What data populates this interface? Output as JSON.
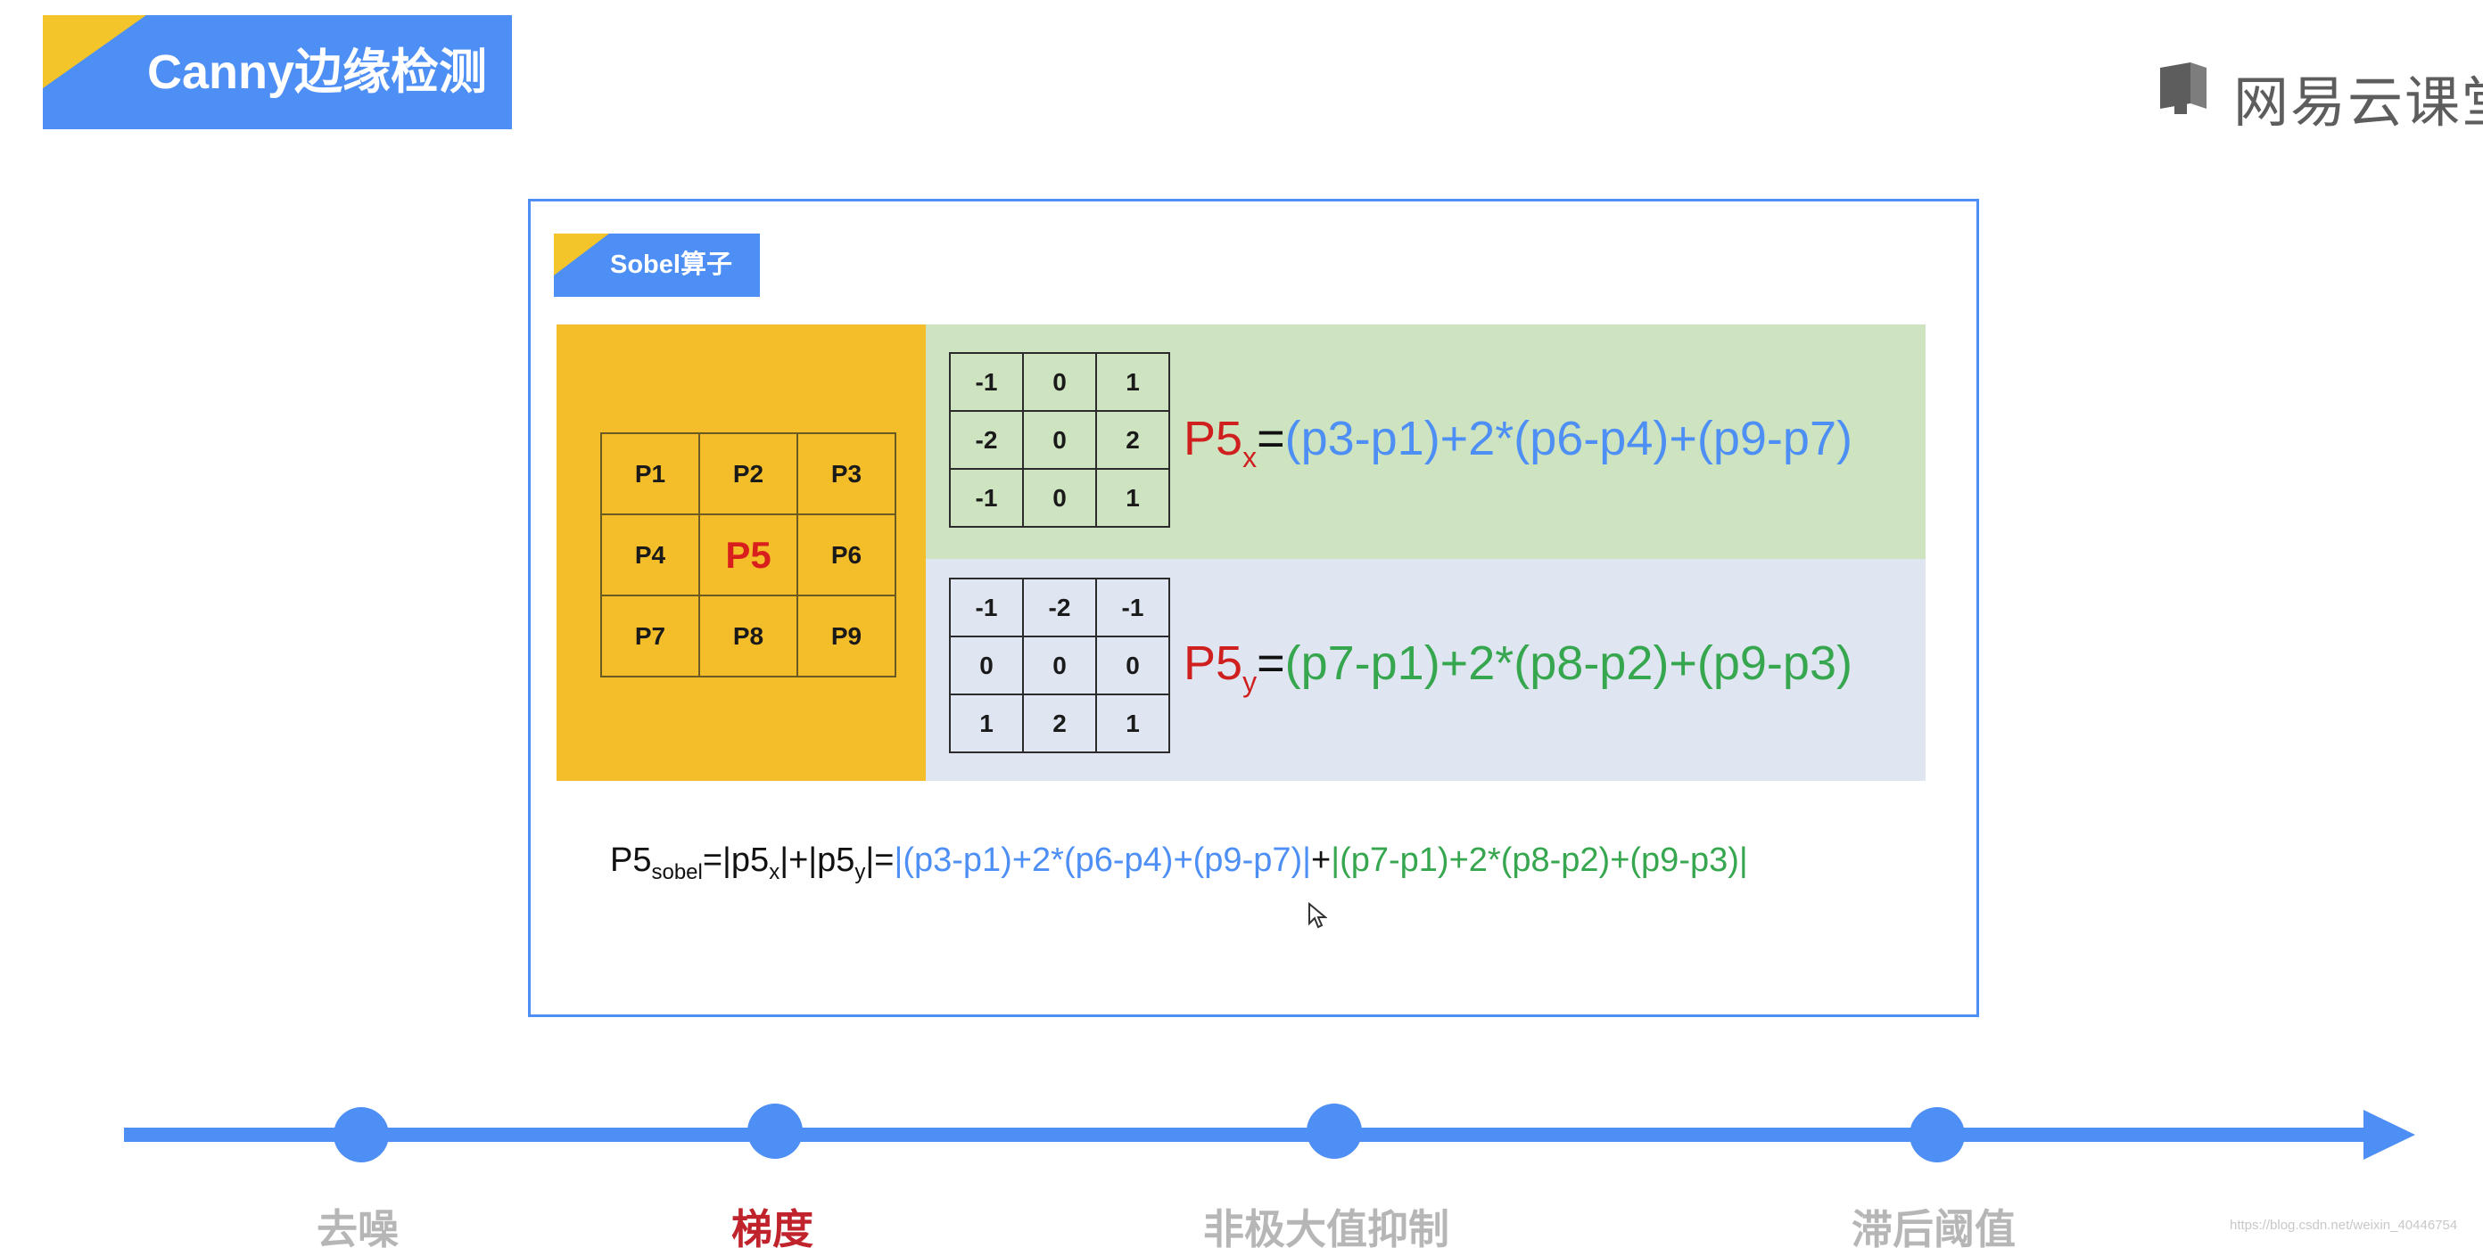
{
  "header": {
    "title": "Canny边缘检测"
  },
  "logo": {
    "text": "网易云课堂",
    "icon": "book-icon"
  },
  "slide": {
    "subtitle": "Sobel算子",
    "pixel_grid": [
      [
        "P1",
        "P2",
        "P3"
      ],
      [
        "P4",
        "P5",
        "P6"
      ],
      [
        "P7",
        "P8",
        "P9"
      ]
    ],
    "kernel_x": [
      [
        "-1",
        "0",
        "1"
      ],
      [
        "-2",
        "0",
        "2"
      ],
      [
        "-1",
        "0",
        "1"
      ]
    ],
    "kernel_y": [
      [
        "-1",
        "-2",
        "-1"
      ],
      [
        "0",
        "0",
        "0"
      ],
      [
        "1",
        "2",
        "1"
      ]
    ],
    "formula_x": {
      "lhs": "P5",
      "sub": "x",
      "eq": "=",
      "rhs": "(p3-p1)+2*(p6-p4)+(p9-p7)"
    },
    "formula_y": {
      "lhs": "P5",
      "sub": "y",
      "eq": "=",
      "rhs": "(p7-p1)+2*(p8-p2)+(p9-p3)"
    },
    "formula_sobel": {
      "lhs": "P5",
      "lhs_sub": "sobel",
      "part1": "=|p5",
      "part1_sub": "x",
      "part2": "|+|p5",
      "part2_sub": "y",
      "part3": "|=",
      "blue_term": "|(p3-p1)+2*(p6-p4)+(p9-p7)|",
      "plus": "+",
      "green_term": "|(p7-p1)+2*(p8-p2)+(p9-p3)|"
    }
  },
  "timeline": {
    "stages": [
      {
        "label": "去噪",
        "active": false
      },
      {
        "label": "梯度",
        "active": true
      },
      {
        "label": "非极大值抑制",
        "active": false
      },
      {
        "label": "滞后阈值",
        "active": false
      }
    ]
  },
  "watermark": "https://blog.csdn.net/weixin_40446754",
  "colors": {
    "accent_blue": "#4e8ff5",
    "accent_yellow": "#f4c42b",
    "active_red": "#c0232b",
    "green": "#36a64f"
  }
}
